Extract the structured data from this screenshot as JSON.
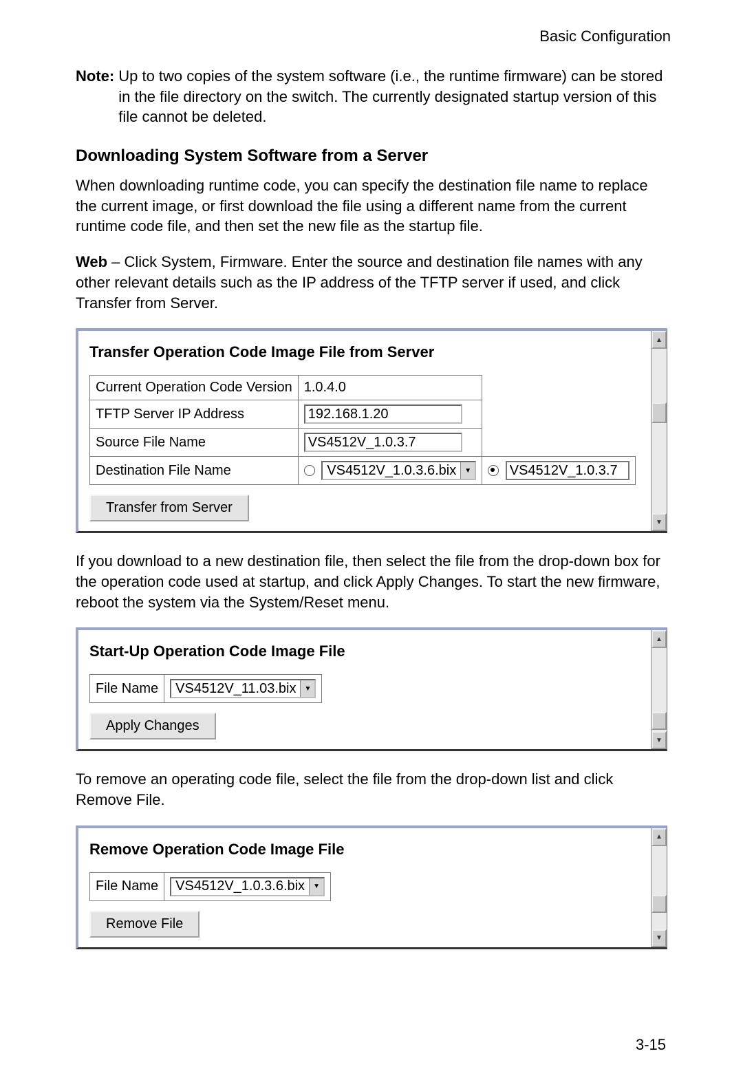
{
  "header": "Basic Configuration",
  "note_label": "Note:",
  "note_text": "Up to two copies of the system software (i.e., the runtime firmware) can be stored in the file directory on the switch. The currently designated startup version of this file cannot be deleted.",
  "section_title": "Downloading System Software from a Server",
  "para1": "When downloading runtime code, you can specify the destination file name to replace the current image, or first download the file using a different name from the current runtime code file, and then set the new file as the startup file.",
  "para2_bold": "Web",
  "para2_rest": " – Click System, Firmware. Enter the source and destination file names with any other relevant details such as the IP address of the TFTP server if used, and click Transfer from Server.",
  "panel1": {
    "title": "Transfer Operation Code Image File from Server",
    "rows": {
      "curr_label": "Current Operation Code Version",
      "curr_value": "1.0.4.0",
      "tftp_label": "TFTP Server IP Address",
      "tftp_value": "192.168.1.20",
      "src_label": "Source File Name",
      "src_value": "VS4512V_1.0.3.7",
      "dest_label": "Destination File Name",
      "dest_dd": "VS4512V_1.0.3.6.bix",
      "dest_radio_text": "VS4512V_1.0.3.7"
    },
    "button": "Transfer from Server"
  },
  "para3": "If you download to a new destination file, then select the file from the drop-down box for the operation code used at startup, and click Apply Changes. To start the new firmware, reboot the system via the System/Reset menu.",
  "panel2": {
    "title": "Start-Up Operation Code Image File",
    "file_label": "File Name",
    "file_value": "VS4512V_11.03.bix",
    "button": "Apply Changes"
  },
  "para4": "To remove an operating code file, select the file from the drop-down list and click Remove File.",
  "panel3": {
    "title": "Remove Operation Code Image File",
    "file_label": "File Name",
    "file_value": "VS4512V_1.0.3.6.bix",
    "button": "Remove File"
  },
  "page_number": "3-15"
}
